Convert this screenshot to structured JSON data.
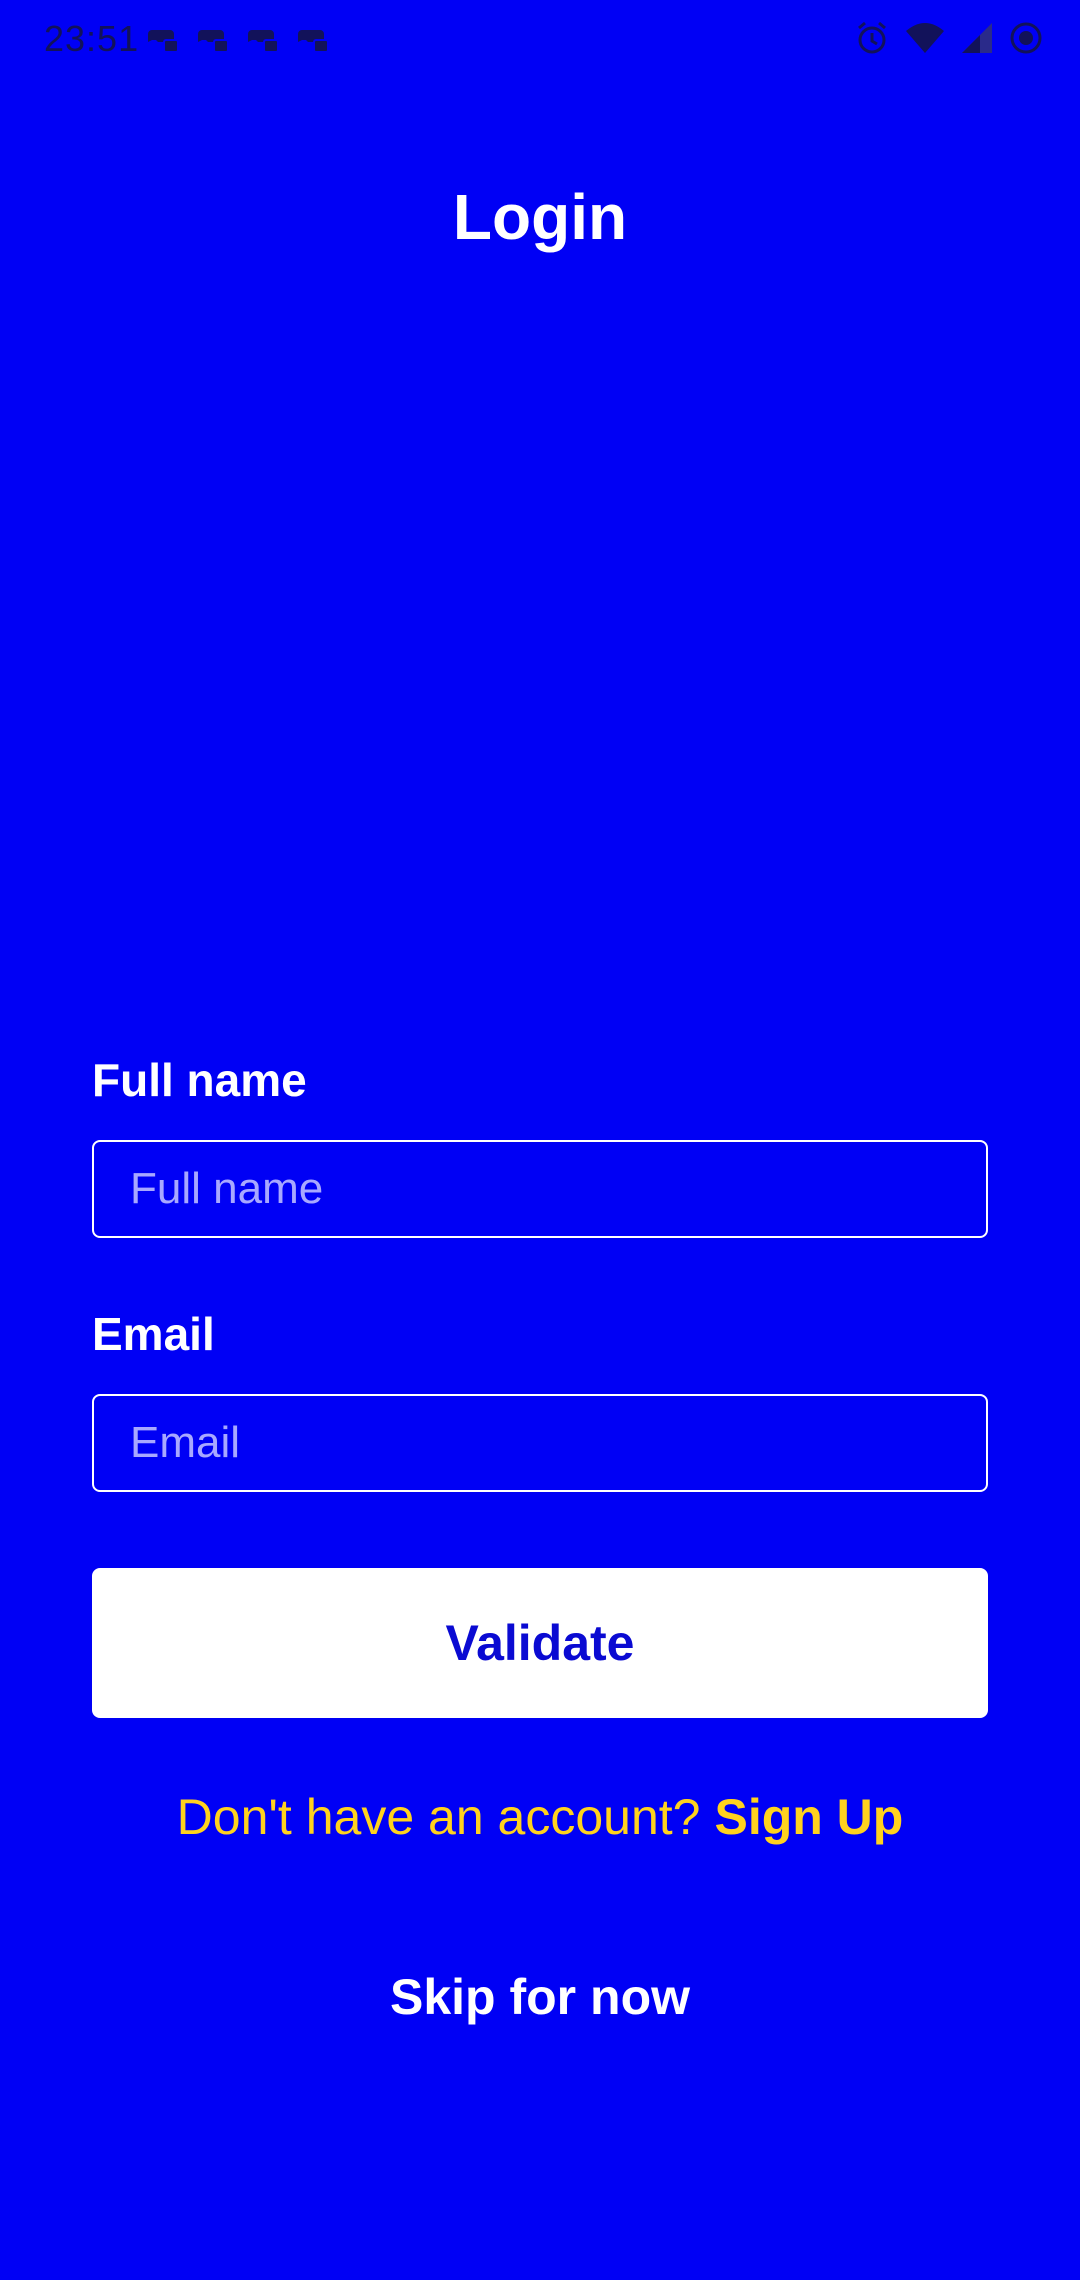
{
  "status_bar": {
    "time": "23:51",
    "notification_icons": [
      "game-controller-icon",
      "game-controller-icon",
      "game-controller-icon",
      "game-controller-icon"
    ],
    "system_icons": [
      "alarm-icon",
      "wifi-icon",
      "signal-icon",
      "record-icon"
    ]
  },
  "page": {
    "title": "Login"
  },
  "form": {
    "full_name": {
      "label": "Full name",
      "placeholder": "Full name",
      "value": ""
    },
    "email": {
      "label": "Email",
      "placeholder": "Email",
      "value": ""
    },
    "validate_label": "Validate"
  },
  "signup": {
    "prompt": "Don't have an account?",
    "link": "Sign Up"
  },
  "skip": {
    "label": "Skip for now"
  },
  "colors": {
    "background": "#0000f5",
    "accent": "#ffd21e",
    "button_text": "#0a0ad2",
    "text": "#ffffff"
  }
}
